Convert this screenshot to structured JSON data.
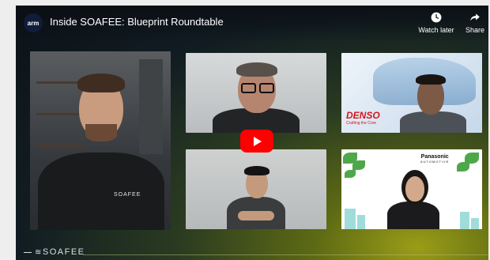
{
  "channel": {
    "logo_text": "arm"
  },
  "video": {
    "title": "Inside SOAFEE: Blueprint Roundtable"
  },
  "actions": {
    "watch_later": "Watch later",
    "share": "Share"
  },
  "tiles": {
    "shirt_logo": "SOAFEE",
    "denso": {
      "logo": "DENSO",
      "tagline": "Crafting the Core"
    },
    "panasonic": {
      "logo": "Panasonic",
      "sub": "AUTOMOTIVE"
    }
  },
  "footer": {
    "brand": "SOAFEE"
  }
}
